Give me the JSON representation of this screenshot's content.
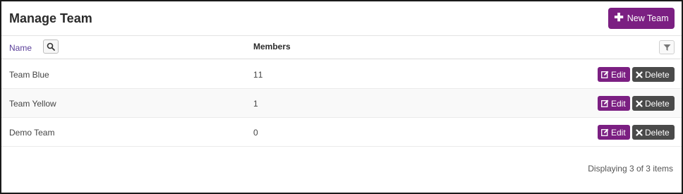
{
  "header": {
    "title": "Manage Team",
    "new_button_label": "New Team",
    "new_button_icon": "plus-icon"
  },
  "columns": {
    "name": "Name",
    "members": "Members",
    "search_icon": "search-icon",
    "filter_icon": "filter-icon"
  },
  "rows": [
    {
      "name": "Team Blue",
      "members": "11",
      "edit_label": "Edit",
      "delete_label": "Delete"
    },
    {
      "name": "Team Yellow",
      "members": "1",
      "edit_label": "Edit",
      "delete_label": "Delete"
    },
    {
      "name": "Demo Team",
      "members": "0",
      "edit_label": "Edit",
      "delete_label": "Delete"
    }
  ],
  "footer": {
    "status": "Displaying 3 of 3 items"
  },
  "colors": {
    "primary": "#7b1f82",
    "danger_dark": "#4a4a4a",
    "link": "#5a3f99"
  }
}
